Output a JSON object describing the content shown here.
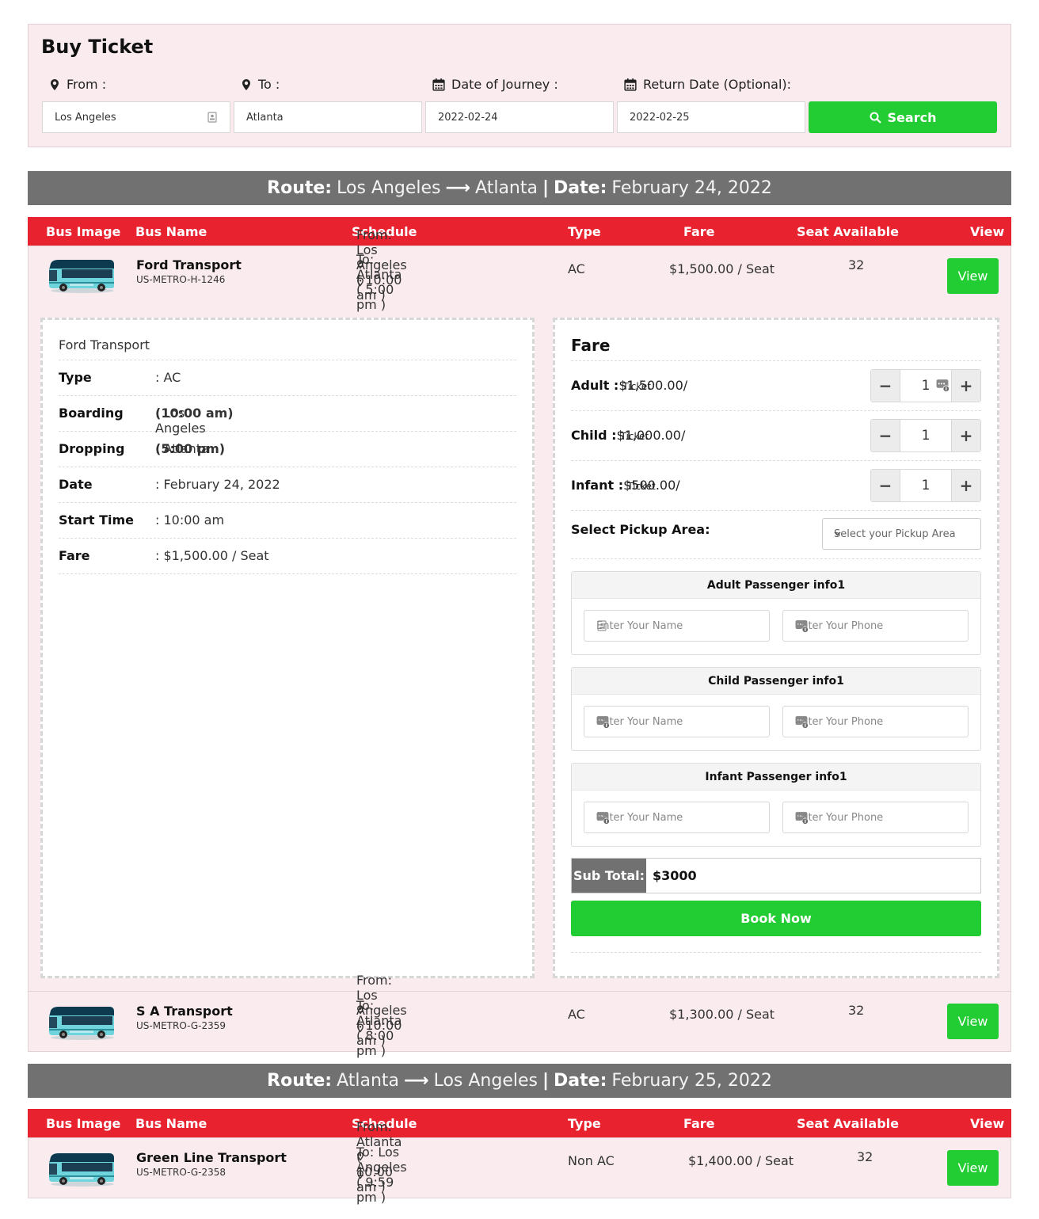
{
  "search": {
    "title": "Buy Ticket",
    "from_label": "From :",
    "to_label": "To :",
    "date_label": "Date of Journey :",
    "return_label": "Return Date (Optional):",
    "from_value": "Los Angeles",
    "to_value": "Atlanta",
    "date_value": "2022-02-24",
    "return_value": "2022-02-25",
    "search_label": "Search"
  },
  "routes": [
    {
      "route_label": "Route:",
      "from": "Los Angeles",
      "to": "Atlanta",
      "arrow": "⟶",
      "sep": "|",
      "date_label": "Date:",
      "date": "February 24, 2022"
    },
    {
      "route_label": "Route:",
      "from": "Atlanta",
      "to": "Los Angeles",
      "arrow": "⟶",
      "sep": "|",
      "date_label": "Date:",
      "date": "February 25, 2022"
    }
  ],
  "table_headers": [
    "Bus Image",
    "Bus Name",
    "Schedule",
    "Type",
    "Fare",
    "Seat Available",
    "View"
  ],
  "buses": [
    {
      "name": "Ford Transport",
      "code": "US-METRO-H-1246",
      "from": "From: Los Angeles ( 10:00 am )",
      "to": "To: Atlanta ( 5:00 pm )",
      "type": "AC",
      "fare": "$1,500.00 / Seat",
      "seats": "32",
      "view": "View"
    },
    {
      "name": "S A Transport",
      "code": "US-METRO-G-2359",
      "from": "From: Los Angeles ( 10:00 am )",
      "to": "To: Atlanta ( 8:00 pm )",
      "type": "AC",
      "fare": "$1,300.00 / Seat",
      "seats": "32",
      "view": "View"
    },
    {
      "name": "Green Line Transport",
      "code": "US-METRO-G-2358",
      "from": "From: Atlanta ( 10:00 am )",
      "to": "To: Los Angeles ( 9:59 pm )",
      "type": "Non AC",
      "fare": "$1,400.00 / Seat",
      "seats": "32",
      "view": "View"
    }
  ],
  "details": {
    "title": "Ford Transport",
    "rows": [
      {
        "label": "Type",
        "value": ": AC",
        "bold": ""
      },
      {
        "label": "Boarding",
        "value": ": Los Angeles ",
        "bold": "(10:00 am)"
      },
      {
        "label": "Dropping",
        "value": ": Atlanta ",
        "bold": "(5:00 pm)"
      },
      {
        "label": "Date",
        "value": ": February 24, 2022",
        "bold": ""
      },
      {
        "label": "Start Time",
        "value": ": 10:00 am",
        "bold": ""
      },
      {
        "label": "Fare",
        "value": ": $1,500.00 / Seat",
        "bold": ""
      }
    ]
  },
  "fare": {
    "title": "Fare",
    "items": [
      {
        "label": "Adult :",
        "price": " $1,500.00/",
        "unit": "Ticket",
        "qty": "1"
      },
      {
        "label": "Child :",
        "price": " $1,000.00/",
        "unit": "Ticket",
        "qty": "1"
      },
      {
        "label": "Infant :",
        "price": " $500.00/",
        "unit": "Ticket",
        "qty": "1"
      }
    ],
    "minus": "−",
    "plus": "+",
    "pickup_label": "Select Pickup Area:",
    "pickup_placeholder": "Select your Pickup Area",
    "passengers": [
      {
        "title": "Adult Passenger info1",
        "name_ph": "Enter Your Name",
        "phone_ph": "Enter Your Phone"
      },
      {
        "title": "Child Passenger info1",
        "name_ph": "Enter Your Name",
        "phone_ph": "Enter Your Phone"
      },
      {
        "title": "Infant Passenger info1",
        "name_ph": "Enter Your Name",
        "phone_ph": "Enter Your Phone"
      }
    ],
    "subtotal_label": "Sub Total:",
    "subtotal_value": "$3000",
    "book_label": "Book Now"
  },
  "colors": {
    "accent_green": "#22cc33",
    "header_red": "#e8232f",
    "route_gray": "#717171",
    "panel_pink": "#f9ebee"
  }
}
